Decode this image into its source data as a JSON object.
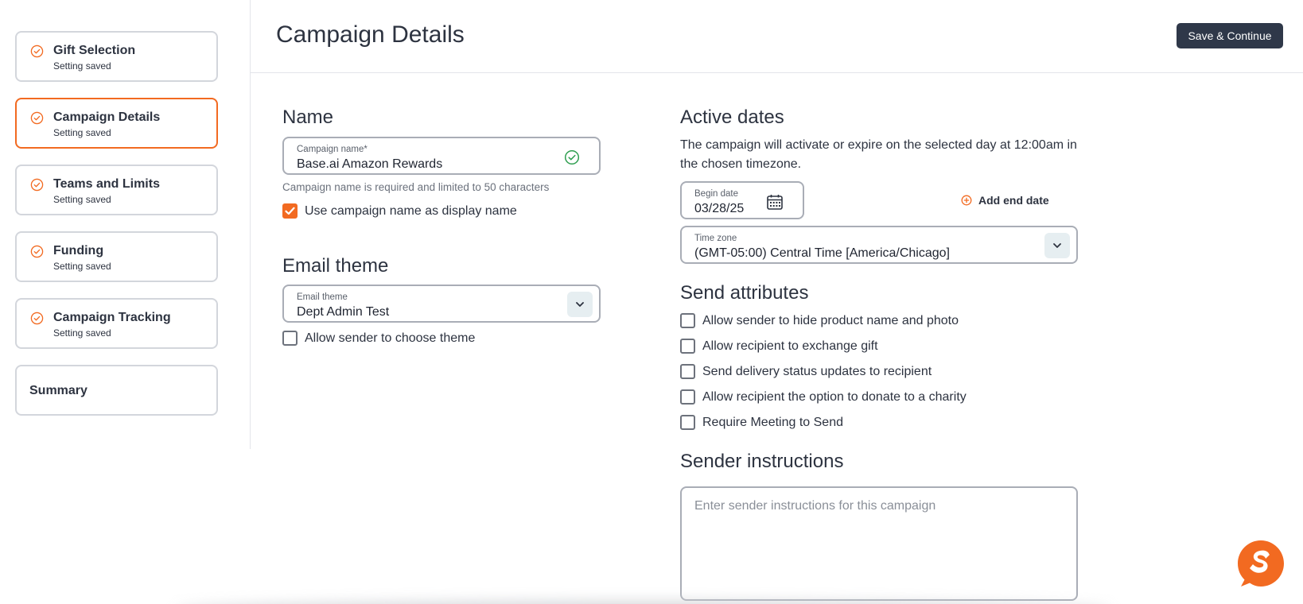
{
  "sidebar": {
    "steps": [
      {
        "title": "Gift Selection",
        "status": "Setting saved"
      },
      {
        "title": "Campaign Details",
        "status": "Setting saved"
      },
      {
        "title": "Teams and Limits",
        "status": "Setting saved"
      },
      {
        "title": "Funding",
        "status": "Setting saved"
      },
      {
        "title": "Campaign Tracking",
        "status": "Setting saved"
      },
      {
        "title": "Summary"
      }
    ],
    "active_step": "Campaign Details"
  },
  "header": {
    "title": "Campaign Details",
    "save_label": "Save & Continue"
  },
  "name_section": {
    "heading": "Name",
    "campaign_name_label": "Campaign name*",
    "campaign_name_value": "Base.ai Amazon Rewards",
    "helper": "Campaign name is required and limited to 50 characters",
    "use_display_name_label": "Use campaign name as display name",
    "use_display_name_checked": true
  },
  "email_theme": {
    "heading": "Email theme",
    "field_label": "Email theme",
    "value": "Dept Admin Test",
    "allow_choose_label": "Allow sender to choose theme",
    "allow_choose_checked": false
  },
  "active_dates": {
    "heading": "Active dates",
    "description": "The campaign will activate or expire on the selected day at 12:00am in the chosen timezone.",
    "begin_label": "Begin date",
    "begin_value": "03/28/25",
    "add_end_label": "Add end date",
    "tz_label": "Time zone",
    "tz_value": "(GMT-05:00) Central Time [America/Chicago]"
  },
  "send_attributes": {
    "heading": "Send attributes",
    "options": [
      {
        "label": "Allow sender to hide product name and photo",
        "checked": false
      },
      {
        "label": "Allow recipient to exchange gift",
        "checked": false
      },
      {
        "label": "Send delivery status updates to recipient",
        "checked": false
      },
      {
        "label": "Allow recipient the option to donate to a charity",
        "checked": false
      },
      {
        "label": "Require Meeting to Send",
        "checked": false
      }
    ]
  },
  "sender_instructions": {
    "heading": "Sender instructions",
    "placeholder": "Enter sender instructions for this campaign"
  },
  "colors": {
    "accent": "#f26a21",
    "success": "#2e9e4f",
    "primary_button": "#2f3849"
  },
  "icons": [
    "check-circle-icon",
    "calendar-icon",
    "chevron-down-icon",
    "plus-circle-icon",
    "sendoso-logo-icon"
  ]
}
